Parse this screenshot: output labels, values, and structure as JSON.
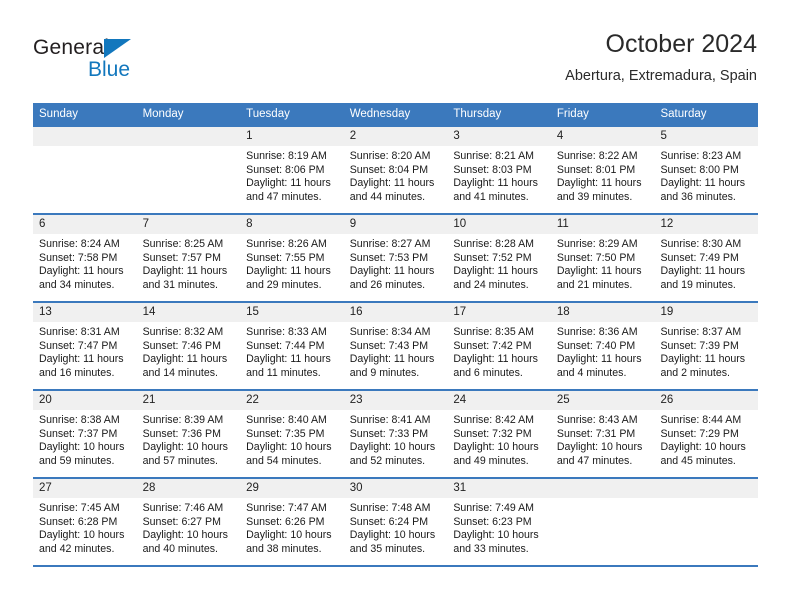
{
  "brand": {
    "name_dark": "General",
    "name_blue": "Blue",
    "triangle_icon": "logo-triangle",
    "accent_color": "#1277bd"
  },
  "header": {
    "title": "October 2024",
    "subtitle": "Abertura, Extremadura, Spain"
  },
  "theme": {
    "header_blue": "#3b79bd",
    "daynum_band": "#f0f0f0",
    "text": "#1a1a1a"
  },
  "weekday_headers": [
    "Sunday",
    "Monday",
    "Tuesday",
    "Wednesday",
    "Thursday",
    "Friday",
    "Saturday"
  ],
  "labels": {
    "sunrise_prefix": "Sunrise:",
    "sunset_prefix": "Sunset:",
    "daylight_prefix": "Daylight:"
  },
  "weeks": [
    {
      "days": [
        {
          "num": "",
          "l1": "",
          "l2": "",
          "l3": "",
          "l4": ""
        },
        {
          "num": "",
          "l1": "",
          "l2": "",
          "l3": "",
          "l4": ""
        },
        {
          "num": "1",
          "l1": "Sunrise: 8:19 AM",
          "l2": "Sunset: 8:06 PM",
          "l3": "Daylight: 11 hours",
          "l4": "and 47 minutes."
        },
        {
          "num": "2",
          "l1": "Sunrise: 8:20 AM",
          "l2": "Sunset: 8:04 PM",
          "l3": "Daylight: 11 hours",
          "l4": "and 44 minutes."
        },
        {
          "num": "3",
          "l1": "Sunrise: 8:21 AM",
          "l2": "Sunset: 8:03 PM",
          "l3": "Daylight: 11 hours",
          "l4": "and 41 minutes."
        },
        {
          "num": "4",
          "l1": "Sunrise: 8:22 AM",
          "l2": "Sunset: 8:01 PM",
          "l3": "Daylight: 11 hours",
          "l4": "and 39 minutes."
        },
        {
          "num": "5",
          "l1": "Sunrise: 8:23 AM",
          "l2": "Sunset: 8:00 PM",
          "l3": "Daylight: 11 hours",
          "l4": "and 36 minutes."
        }
      ]
    },
    {
      "days": [
        {
          "num": "6",
          "l1": "Sunrise: 8:24 AM",
          "l2": "Sunset: 7:58 PM",
          "l3": "Daylight: 11 hours",
          "l4": "and 34 minutes."
        },
        {
          "num": "7",
          "l1": "Sunrise: 8:25 AM",
          "l2": "Sunset: 7:57 PM",
          "l3": "Daylight: 11 hours",
          "l4": "and 31 minutes."
        },
        {
          "num": "8",
          "l1": "Sunrise: 8:26 AM",
          "l2": "Sunset: 7:55 PM",
          "l3": "Daylight: 11 hours",
          "l4": "and 29 minutes."
        },
        {
          "num": "9",
          "l1": "Sunrise: 8:27 AM",
          "l2": "Sunset: 7:53 PM",
          "l3": "Daylight: 11 hours",
          "l4": "and 26 minutes."
        },
        {
          "num": "10",
          "l1": "Sunrise: 8:28 AM",
          "l2": "Sunset: 7:52 PM",
          "l3": "Daylight: 11 hours",
          "l4": "and 24 minutes."
        },
        {
          "num": "11",
          "l1": "Sunrise: 8:29 AM",
          "l2": "Sunset: 7:50 PM",
          "l3": "Daylight: 11 hours",
          "l4": "and 21 minutes."
        },
        {
          "num": "12",
          "l1": "Sunrise: 8:30 AM",
          "l2": "Sunset: 7:49 PM",
          "l3": "Daylight: 11 hours",
          "l4": "and 19 minutes."
        }
      ]
    },
    {
      "days": [
        {
          "num": "13",
          "l1": "Sunrise: 8:31 AM",
          "l2": "Sunset: 7:47 PM",
          "l3": "Daylight: 11 hours",
          "l4": "and 16 minutes."
        },
        {
          "num": "14",
          "l1": "Sunrise: 8:32 AM",
          "l2": "Sunset: 7:46 PM",
          "l3": "Daylight: 11 hours",
          "l4": "and 14 minutes."
        },
        {
          "num": "15",
          "l1": "Sunrise: 8:33 AM",
          "l2": "Sunset: 7:44 PM",
          "l3": "Daylight: 11 hours",
          "l4": "and 11 minutes."
        },
        {
          "num": "16",
          "l1": "Sunrise: 8:34 AM",
          "l2": "Sunset: 7:43 PM",
          "l3": "Daylight: 11 hours",
          "l4": "and 9 minutes."
        },
        {
          "num": "17",
          "l1": "Sunrise: 8:35 AM",
          "l2": "Sunset: 7:42 PM",
          "l3": "Daylight: 11 hours",
          "l4": "and 6 minutes."
        },
        {
          "num": "18",
          "l1": "Sunrise: 8:36 AM",
          "l2": "Sunset: 7:40 PM",
          "l3": "Daylight: 11 hours",
          "l4": "and 4 minutes."
        },
        {
          "num": "19",
          "l1": "Sunrise: 8:37 AM",
          "l2": "Sunset: 7:39 PM",
          "l3": "Daylight: 11 hours",
          "l4": "and 2 minutes."
        }
      ]
    },
    {
      "days": [
        {
          "num": "20",
          "l1": "Sunrise: 8:38 AM",
          "l2": "Sunset: 7:37 PM",
          "l3": "Daylight: 10 hours",
          "l4": "and 59 minutes."
        },
        {
          "num": "21",
          "l1": "Sunrise: 8:39 AM",
          "l2": "Sunset: 7:36 PM",
          "l3": "Daylight: 10 hours",
          "l4": "and 57 minutes."
        },
        {
          "num": "22",
          "l1": "Sunrise: 8:40 AM",
          "l2": "Sunset: 7:35 PM",
          "l3": "Daylight: 10 hours",
          "l4": "and 54 minutes."
        },
        {
          "num": "23",
          "l1": "Sunrise: 8:41 AM",
          "l2": "Sunset: 7:33 PM",
          "l3": "Daylight: 10 hours",
          "l4": "and 52 minutes."
        },
        {
          "num": "24",
          "l1": "Sunrise: 8:42 AM",
          "l2": "Sunset: 7:32 PM",
          "l3": "Daylight: 10 hours",
          "l4": "and 49 minutes."
        },
        {
          "num": "25",
          "l1": "Sunrise: 8:43 AM",
          "l2": "Sunset: 7:31 PM",
          "l3": "Daylight: 10 hours",
          "l4": "and 47 minutes."
        },
        {
          "num": "26",
          "l1": "Sunrise: 8:44 AM",
          "l2": "Sunset: 7:29 PM",
          "l3": "Daylight: 10 hours",
          "l4": "and 45 minutes."
        }
      ]
    },
    {
      "days": [
        {
          "num": "27",
          "l1": "Sunrise: 7:45 AM",
          "l2": "Sunset: 6:28 PM",
          "l3": "Daylight: 10 hours",
          "l4": "and 42 minutes."
        },
        {
          "num": "28",
          "l1": "Sunrise: 7:46 AM",
          "l2": "Sunset: 6:27 PM",
          "l3": "Daylight: 10 hours",
          "l4": "and 40 minutes."
        },
        {
          "num": "29",
          "l1": "Sunrise: 7:47 AM",
          "l2": "Sunset: 6:26 PM",
          "l3": "Daylight: 10 hours",
          "l4": "and 38 minutes."
        },
        {
          "num": "30",
          "l1": "Sunrise: 7:48 AM",
          "l2": "Sunset: 6:24 PM",
          "l3": "Daylight: 10 hours",
          "l4": "and 35 minutes."
        },
        {
          "num": "31",
          "l1": "Sunrise: 7:49 AM",
          "l2": "Sunset: 6:23 PM",
          "l3": "Daylight: 10 hours",
          "l4": "and 33 minutes."
        },
        {
          "num": "",
          "l1": "",
          "l2": "",
          "l3": "",
          "l4": ""
        },
        {
          "num": "",
          "l1": "",
          "l2": "",
          "l3": "",
          "l4": ""
        }
      ]
    }
  ]
}
